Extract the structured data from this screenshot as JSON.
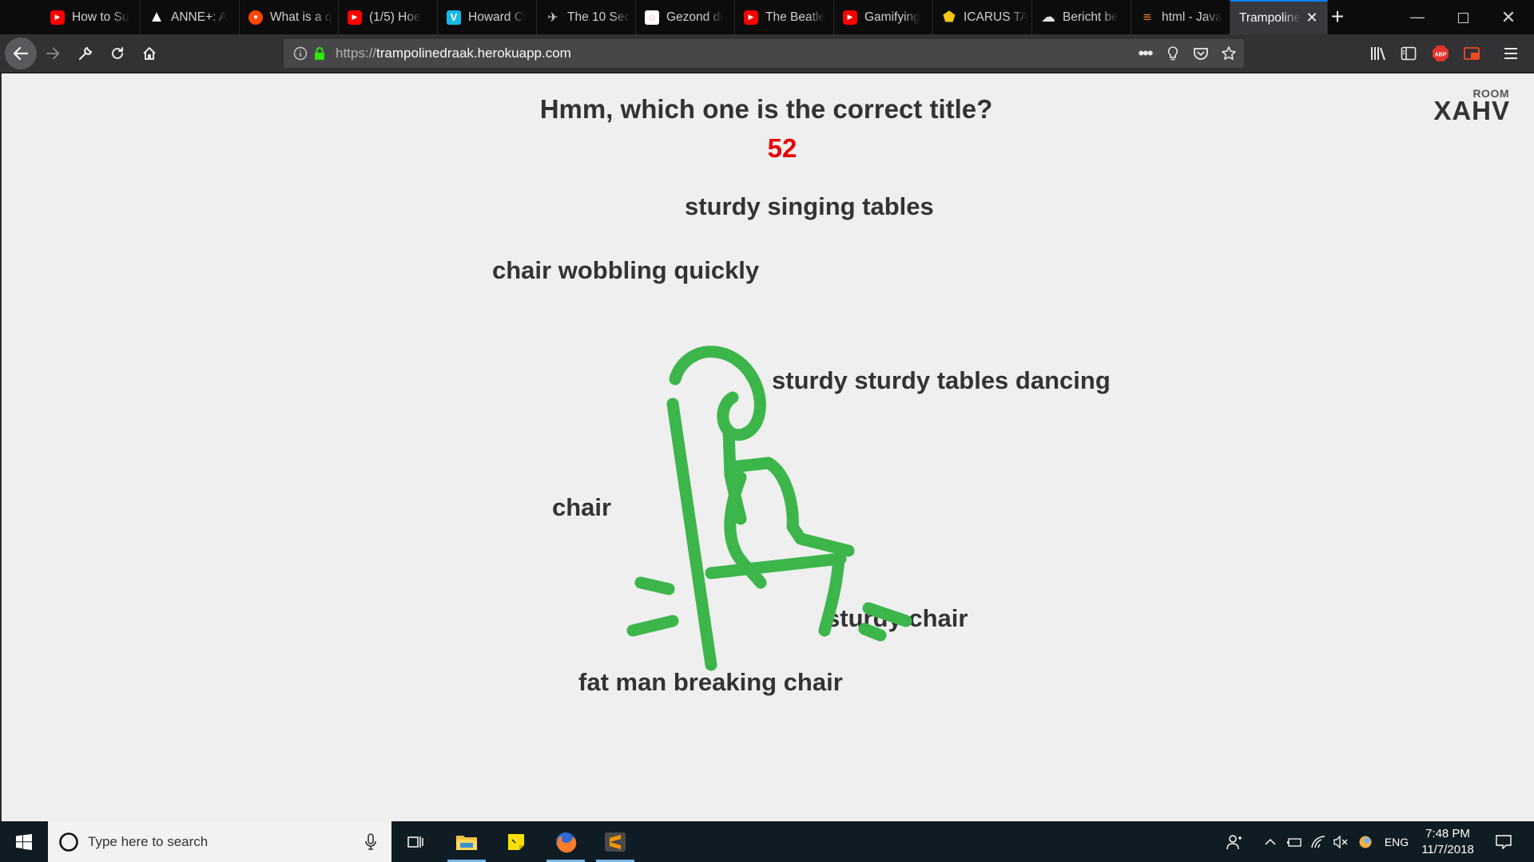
{
  "browser": {
    "tabs": [
      {
        "label": "How to Su",
        "icon": "youtube-icon",
        "color": "#ff0000",
        "glyph": "▶"
      },
      {
        "label": "ANNE+: A",
        "icon": "warning-icon",
        "color": "#ffffff",
        "glyph": "!"
      },
      {
        "label": "What is a q",
        "icon": "reddit-icon",
        "color": "#ff4500",
        "glyph": "●"
      },
      {
        "label": "(1/5) Hoe",
        "icon": "youtube-icon",
        "color": "#ff0000",
        "glyph": "▶"
      },
      {
        "label": "Howard Cl",
        "icon": "vimeo-icon",
        "color": "#1ab7ea",
        "glyph": "V"
      },
      {
        "label": "The 10 Sec",
        "icon": "bird-icon",
        "color": "#c8c8d0",
        "glyph": "✈"
      },
      {
        "label": "Gezond di",
        "icon": "page-icon",
        "color": "#ffffff",
        "glyph": "◌"
      },
      {
        "label": "The Beatle",
        "icon": "youtube-icon",
        "color": "#ff0000",
        "glyph": "▶"
      },
      {
        "label": "Gamifying",
        "icon": "youtube-icon",
        "color": "#ff0000",
        "glyph": "▶"
      },
      {
        "label": "ICARUS TA",
        "icon": "shield-icon",
        "color": "#f5c518",
        "glyph": "◆"
      },
      {
        "label": "Bericht be",
        "icon": "forum-icon",
        "color": "#e0e0e0",
        "glyph": "☁"
      },
      {
        "label": "html - Java",
        "icon": "stackoverflow-icon",
        "color": "#f48024",
        "glyph": "≡"
      }
    ],
    "active_tab": {
      "label": "Trampoline",
      "close": "✕"
    },
    "new_tab": "+",
    "url_proto": "https://",
    "url_host": "trampolinedraak.herokuapp.com",
    "accent": "#0a84ff"
  },
  "game": {
    "question": "Hmm, which one is the correct title?",
    "timer": "52",
    "room_label": "ROOM",
    "room_code": "XAHV",
    "options": [
      {
        "text": "sturdy singing tables"
      },
      {
        "text": "chair wobbling quickly"
      },
      {
        "text": "sturdy sturdy tables dancing"
      },
      {
        "text": "chair"
      },
      {
        "text": "sturdy chair"
      },
      {
        "text": "fat man breaking chair"
      }
    ],
    "drawing_color": "#3cb54a",
    "timer_color": "#e80000"
  },
  "taskbar": {
    "search_placeholder": "Type here to search",
    "lang": "ENG",
    "time": "7:48 PM",
    "date": "11/7/2018"
  }
}
